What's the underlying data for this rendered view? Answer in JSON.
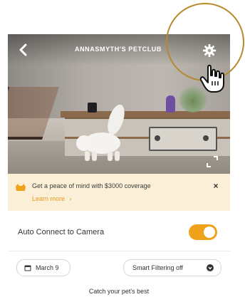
{
  "header": {
    "title": "ANNASMYTH'S PETCLUB",
    "back_icon": "chevron-left-icon",
    "settings_icon": "gear-icon"
  },
  "promo": {
    "text": "Get a peace of mind with $3000 coverage",
    "link": "Learn more",
    "link_arrow": "›",
    "close": "×"
  },
  "settings": {
    "auto_connect_label": "Auto Connect to Camera",
    "auto_connect_on": true
  },
  "filters": {
    "date_label": "March 9",
    "smart_filter_label": "Smart Filtering off"
  },
  "footer": {
    "text": "Catch your pet's best"
  },
  "colors": {
    "accent": "#f0a31a",
    "promo_bg": "#fbf0d7",
    "link": "#e39a1f",
    "ring": "#b58a2e"
  }
}
